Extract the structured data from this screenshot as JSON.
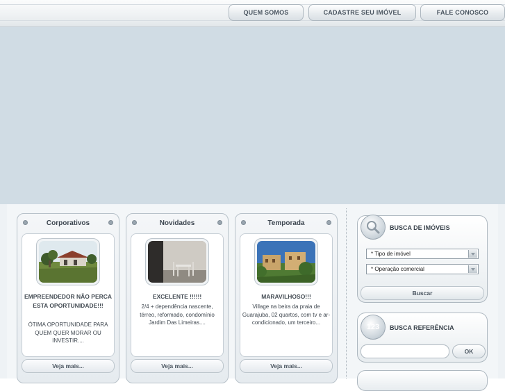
{
  "nav": {
    "items": [
      {
        "label": "QUEM SOMOS"
      },
      {
        "label": "CADASTRE SEU IMÓVEL"
      },
      {
        "label": "FALE CONOSCO"
      }
    ]
  },
  "cards": [
    {
      "header": "Corporativos",
      "title": "EMPREENDEDOR NÃO PERCA ESTA OPORTUNIDADE!!!",
      "description": "ÓTIMA OPORTUNIDADE PARA QUEM QUER MORAR OU INVESTIR....",
      "more_label": "Veja mais..."
    },
    {
      "header": "Novidades",
      "title": "EXCELENTE !!!!!!",
      "description": "2/4 + dependência nascente, térreo, reformado, condomínio Jardim Das Limeiras....",
      "more_label": "Veja mais..."
    },
    {
      "header": "Temporada",
      "title": "MARAVILHOSO!!!",
      "description": "Village na beira da praia de Guarajuba, 02 quartos, com tv e ar- condicionado, um terceiro...",
      "more_label": "Veja mais..."
    }
  ],
  "search": {
    "title": "BUSCA DE IMÓVEIS",
    "icon": "magnifier-icon",
    "tipo_select": "* Tipo de imóvel",
    "operacao_select": "* Operação comercial",
    "button_label": "Buscar"
  },
  "reference": {
    "title": "BUSCA REFERÊNCIA",
    "icon_text": "123",
    "input_value": "",
    "ok_label": "OK"
  },
  "colors": {
    "banner": "#d0dce4",
    "panel_bg": "#f3f6f8",
    "text": "#3d4650"
  }
}
